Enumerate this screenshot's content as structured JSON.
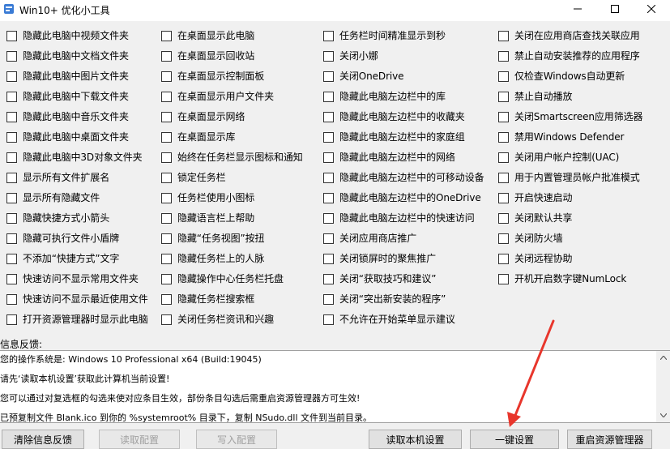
{
  "window": {
    "title": "Win10+ 优化小工具",
    "min_glyph": "—",
    "max_glyph": "☐",
    "close_glyph": "✕"
  },
  "options": {
    "col1": [
      "隐藏此电脑中视频文件夹",
      "隐藏此电脑中文档文件夹",
      "隐藏此电脑中图片文件夹",
      "隐藏此电脑中下载文件夹",
      "隐藏此电脑中音乐文件夹",
      "隐藏此电脑中桌面文件夹",
      "隐藏此电脑中3D对象文件夹",
      "显示所有文件扩展名",
      "显示所有隐藏文件",
      "隐藏快捷方式小箭头",
      "隐藏可执行文件小盾牌",
      "不添加“快捷方式”文字",
      "快速访问不显示常用文件夹",
      "快速访问不显示最近使用文件",
      "打开资源管理器时显示此电脑"
    ],
    "col2": [
      "在桌面显示此电脑",
      "在桌面显示回收站",
      "在桌面显示控制面板",
      "在桌面显示用户文件夹",
      "在桌面显示网络",
      "在桌面显示库",
      "始终在任务栏显示图标和通知",
      "锁定任务栏",
      "任务栏使用小图标",
      "隐藏语言栏上帮助",
      "隐藏“任务视图”按扭",
      "隐藏任务栏上的人脉",
      "隐藏操作中心任务栏托盘",
      "隐藏任务栏搜索框",
      "关闭任务栏资讯和兴趣"
    ],
    "col3": [
      "任务栏时间精准显示到秒",
      "关闭小娜",
      "关闭OneDrive",
      "隐藏此电脑左边栏中的库",
      "隐藏此电脑左边栏中的收藏夹",
      "隐藏此电脑左边栏中的家庭组",
      "隐藏此电脑左边栏中的网络",
      "隐藏此电脑左边栏中的可移动设备",
      "隐藏此电脑左边栏中的OneDrive",
      "隐藏此电脑左边栏中的快速访问",
      "关闭应用商店推广",
      "关闭锁屏时的聚焦推广",
      "关闭“获取技巧和建议”",
      "关闭“突出新安装的程序”",
      "不允许在开始菜单显示建议"
    ],
    "col4": [
      "关闭在应用商店查找关联应用",
      "禁止自动安装推荐的应用程序",
      "仅检查Windows自动更新",
      "禁止自动播放",
      "关闭Smartscreen应用筛选器",
      "禁用Windows Defender",
      "关闭用户帐户控制(UAC)",
      "用于内置管理员帐户批准模式",
      "开启快速启动",
      "关闭默认共享",
      "关闭防火墙",
      "关闭远程协助",
      "开机开启数字键NumLock"
    ]
  },
  "info": {
    "label": "信息反馈:",
    "lines": [
      "您的操作系统是: Windows 10 Professional x64 (Build:19045)",
      "请先‘读取本机设置’获取此计算机当前设置!",
      "您可以通过对复选框的勾选来使对应条目生效，部份条目勾选后需重启资源管理器方可生效!",
      "已预复制文件 Blank.ico 到你的 %systemroot% 目录下，复制 NSudo.dll 文件到当前目录。"
    ]
  },
  "buttons": {
    "clear": "清除信息反馈",
    "read_config": "读取配置",
    "write_config": "写入配置",
    "read_local": "读取本机设置",
    "one_click": "一键设置",
    "restart_explorer": "重启资源管理器"
  },
  "colors": {
    "annotation_arrow": "#e8362c",
    "window_bg": "#f0f0f0",
    "textbox_bg": "#ffffff"
  }
}
